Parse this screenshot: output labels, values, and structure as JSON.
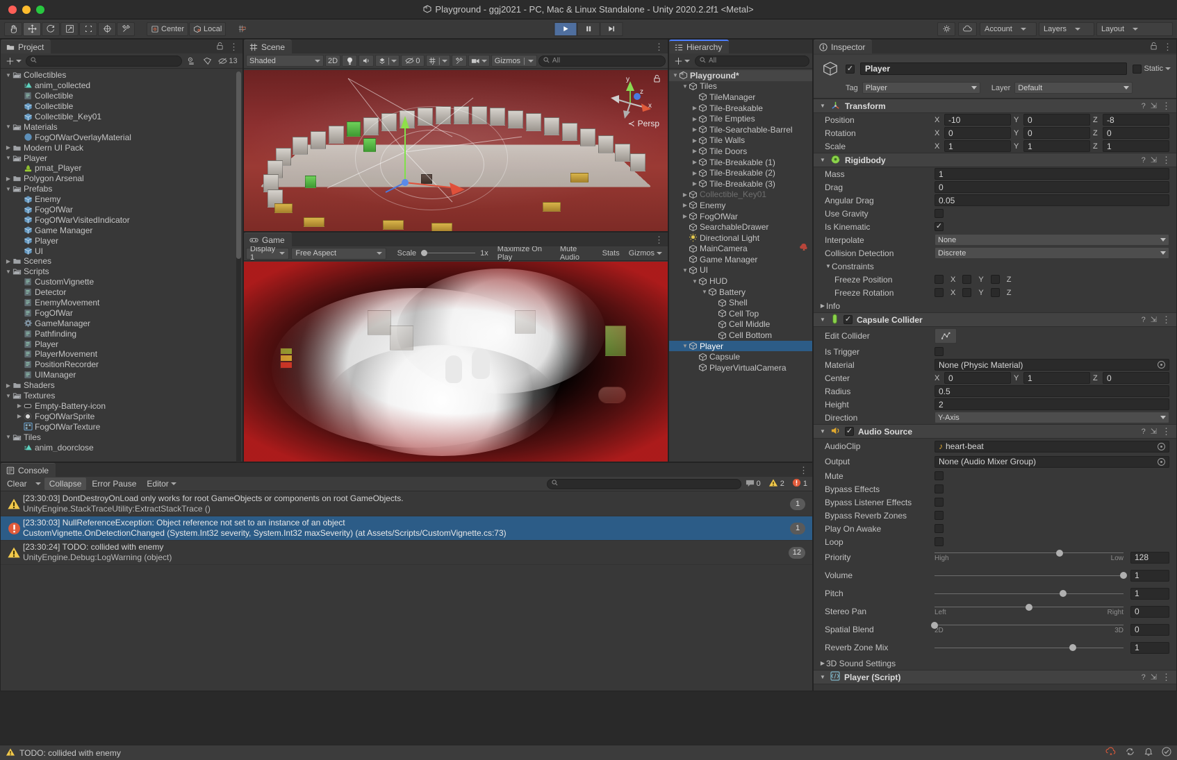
{
  "window": {
    "title": "Playground - ggj2021 - PC, Mac & Linux Standalone - Unity 2020.2.2f1 <Metal>"
  },
  "toolbar": {
    "tools": [
      {
        "name": "hand-tool",
        "glyph": "✋"
      },
      {
        "name": "move-tool",
        "glyph": "✥"
      },
      {
        "name": "rotate-tool",
        "glyph": "⟳"
      },
      {
        "name": "scale-tool",
        "glyph": "⤢"
      },
      {
        "name": "rect-tool",
        "glyph": "⬚"
      },
      {
        "name": "transform-tool",
        "glyph": "✦"
      },
      {
        "name": "custom-tool",
        "glyph": "⚒"
      }
    ],
    "pivot_label": "Center",
    "space_label": "Local",
    "grid_label": "",
    "play": "▶",
    "pause": "❚❚",
    "step": "▶❙",
    "cloud_label": "",
    "account_label": "Account",
    "layers_label": "Layers",
    "layout_label": "Layout"
  },
  "project": {
    "tab_label": "Project",
    "search_placeholder": "",
    "hidden_count": "13",
    "tree": [
      {
        "depth": 1,
        "arrow": "▼",
        "icon": "folder-open",
        "label": "Collectibles"
      },
      {
        "depth": 2,
        "arrow": "",
        "icon": "anim",
        "label": "anim_collected"
      },
      {
        "depth": 2,
        "arrow": "",
        "icon": "script",
        "label": "Collectible"
      },
      {
        "depth": 2,
        "arrow": "",
        "icon": "prefab",
        "label": "Collectible"
      },
      {
        "depth": 2,
        "arrow": "",
        "icon": "prefab",
        "label": "Collectible_Key01"
      },
      {
        "depth": 1,
        "arrow": "▼",
        "icon": "folder-open",
        "label": "Materials"
      },
      {
        "depth": 2,
        "arrow": "",
        "icon": "material",
        "label": "FogOfWarOverlayMaterial"
      },
      {
        "depth": 1,
        "arrow": "▶",
        "icon": "folder",
        "label": "Modern UI Pack"
      },
      {
        "depth": 1,
        "arrow": "▼",
        "icon": "folder-open",
        "label": "Player"
      },
      {
        "depth": 2,
        "arrow": "",
        "icon": "pmat",
        "label": "pmat_Player"
      },
      {
        "depth": 1,
        "arrow": "▶",
        "icon": "folder",
        "label": "Polygon Arsenal"
      },
      {
        "depth": 1,
        "arrow": "▼",
        "icon": "folder-open",
        "label": "Prefabs"
      },
      {
        "depth": 2,
        "arrow": "",
        "icon": "prefab",
        "label": "Enemy"
      },
      {
        "depth": 2,
        "arrow": "",
        "icon": "prefab",
        "label": "FogOfWar"
      },
      {
        "depth": 2,
        "arrow": "",
        "icon": "prefab",
        "label": "FogOfWarVisitedIndicator"
      },
      {
        "depth": 2,
        "arrow": "",
        "icon": "prefab",
        "label": "Game Manager"
      },
      {
        "depth": 2,
        "arrow": "",
        "icon": "prefab",
        "label": "Player"
      },
      {
        "depth": 2,
        "arrow": "",
        "icon": "prefab",
        "label": "UI"
      },
      {
        "depth": 1,
        "arrow": "▶",
        "icon": "folder",
        "label": "Scenes"
      },
      {
        "depth": 1,
        "arrow": "▼",
        "icon": "folder-open",
        "label": "Scripts"
      },
      {
        "depth": 2,
        "arrow": "",
        "icon": "script",
        "label": "CustomVignette"
      },
      {
        "depth": 2,
        "arrow": "",
        "icon": "script",
        "label": "Detector"
      },
      {
        "depth": 2,
        "arrow": "",
        "icon": "script",
        "label": "EnemyMovement"
      },
      {
        "depth": 2,
        "arrow": "",
        "icon": "script",
        "label": "FogOfWar"
      },
      {
        "depth": 2,
        "arrow": "",
        "icon": "gear",
        "label": "GameManager"
      },
      {
        "depth": 2,
        "arrow": "",
        "icon": "script",
        "label": "Pathfinding"
      },
      {
        "depth": 2,
        "arrow": "",
        "icon": "script",
        "label": "Player"
      },
      {
        "depth": 2,
        "arrow": "",
        "icon": "script",
        "label": "PlayerMovement"
      },
      {
        "depth": 2,
        "arrow": "",
        "icon": "script",
        "label": "PositionRecorder"
      },
      {
        "depth": 2,
        "arrow": "",
        "icon": "script",
        "label": "UIManager"
      },
      {
        "depth": 1,
        "arrow": "▶",
        "icon": "folder",
        "label": "Shaders"
      },
      {
        "depth": 1,
        "arrow": "▼",
        "icon": "folder-open",
        "label": "Textures"
      },
      {
        "depth": 2,
        "arrow": "▶",
        "icon": "sprite",
        "label": "Empty-Battery-icon"
      },
      {
        "depth": 2,
        "arrow": "▶",
        "icon": "dot",
        "label": "FogOfWarSprite"
      },
      {
        "depth": 2,
        "arrow": "",
        "icon": "texture",
        "label": "FogOfWarTexture"
      },
      {
        "depth": 1,
        "arrow": "▼",
        "icon": "folder-open",
        "label": "Tiles"
      },
      {
        "depth": 2,
        "arrow": "",
        "icon": "anim",
        "label": "anim_doorclose"
      }
    ]
  },
  "scene": {
    "tab_label": "Scene",
    "shading_mode": "Shaded",
    "mode_2d": "2D",
    "audio_count": "0",
    "gizmos_label": "Gizmos",
    "search_placeholder": "All",
    "persp_label": "Persp",
    "axis_x": "x",
    "axis_y": "y",
    "axis_z": "z"
  },
  "game": {
    "tab_label": "Game",
    "display": "Display 1",
    "aspect": "Free Aspect",
    "scale_label": "Scale",
    "scale_value": "1x",
    "maximize_label": "Maximize On Play",
    "mute_label": "Mute Audio",
    "stats_label": "Stats",
    "gizmos_label": "Gizmos"
  },
  "hierarchy": {
    "tab_label": "Hierarchy",
    "search_placeholder": "All",
    "items": [
      {
        "depth": 0,
        "arrow": "▼",
        "icon": "scene",
        "label": "Playground*",
        "style": "scene-root"
      },
      {
        "depth": 1,
        "arrow": "▼",
        "icon": "cube",
        "label": "Tiles",
        "style": ""
      },
      {
        "depth": 2,
        "arrow": "",
        "icon": "cube",
        "label": "TileManager",
        "style": ""
      },
      {
        "depth": 2,
        "arrow": "▶",
        "icon": "cube",
        "label": "Tile-Breakable",
        "style": ""
      },
      {
        "depth": 2,
        "arrow": "▶",
        "icon": "cube",
        "label": "Tile Empties",
        "style": ""
      },
      {
        "depth": 2,
        "arrow": "▶",
        "icon": "cube",
        "label": "Tile-Searchable-Barrel",
        "style": ""
      },
      {
        "depth": 2,
        "arrow": "▶",
        "icon": "cube",
        "label": "Tile Walls",
        "style": ""
      },
      {
        "depth": 2,
        "arrow": "▶",
        "icon": "cube",
        "label": "Tile Doors",
        "style": ""
      },
      {
        "depth": 2,
        "arrow": "▶",
        "icon": "cube",
        "label": "Tile-Breakable (1)",
        "style": ""
      },
      {
        "depth": 2,
        "arrow": "▶",
        "icon": "cube",
        "label": "Tile-Breakable (2)",
        "style": ""
      },
      {
        "depth": 2,
        "arrow": "▶",
        "icon": "cube",
        "label": "Tile-Breakable (3)",
        "style": ""
      },
      {
        "depth": 1,
        "arrow": "▶",
        "icon": "cube",
        "label": "Collectible_Key01",
        "style": "dim"
      },
      {
        "depth": 1,
        "arrow": "▶",
        "icon": "cube",
        "label": "Enemy",
        "style": ""
      },
      {
        "depth": 1,
        "arrow": "▶",
        "icon": "cube",
        "label": "FogOfWar",
        "style": ""
      },
      {
        "depth": 1,
        "arrow": "",
        "icon": "cube",
        "label": "SearchableDrawer",
        "style": ""
      },
      {
        "depth": 1,
        "arrow": "",
        "icon": "light",
        "label": "Directional Light",
        "style": ""
      },
      {
        "depth": 1,
        "arrow": "",
        "icon": "cube",
        "label": "MainCamera",
        "style": "has-badge"
      },
      {
        "depth": 1,
        "arrow": "",
        "icon": "cube",
        "label": "Game Manager",
        "style": ""
      },
      {
        "depth": 1,
        "arrow": "▼",
        "icon": "cube",
        "label": "UI",
        "style": ""
      },
      {
        "depth": 2,
        "arrow": "▼",
        "icon": "cube",
        "label": "HUD",
        "style": ""
      },
      {
        "depth": 3,
        "arrow": "▼",
        "icon": "cube",
        "label": "Battery",
        "style": ""
      },
      {
        "depth": 4,
        "arrow": "",
        "icon": "cube",
        "label": "Shell",
        "style": ""
      },
      {
        "depth": 4,
        "arrow": "",
        "icon": "cube",
        "label": "Cell Top",
        "style": ""
      },
      {
        "depth": 4,
        "arrow": "",
        "icon": "cube",
        "label": "Cell Middle",
        "style": ""
      },
      {
        "depth": 4,
        "arrow": "",
        "icon": "cube",
        "label": "Cell Bottom",
        "style": ""
      },
      {
        "depth": 1,
        "arrow": "▼",
        "icon": "cube",
        "label": "Player",
        "style": "sel"
      },
      {
        "depth": 2,
        "arrow": "",
        "icon": "cube",
        "label": "Capsule",
        "style": ""
      },
      {
        "depth": 2,
        "arrow": "",
        "icon": "cube",
        "label": "PlayerVirtualCamera",
        "style": ""
      }
    ]
  },
  "inspector": {
    "tab_label": "Inspector",
    "object_name": "Player",
    "static_label": "Static",
    "tag_label": "Tag",
    "tag_value": "Player",
    "layer_label": "Layer",
    "layer_value": "Default",
    "transform": {
      "title": "Transform",
      "rows": [
        {
          "label": "Position",
          "x": "-10",
          "y": "0",
          "z": "-8"
        },
        {
          "label": "Rotation",
          "x": "0",
          "y": "0",
          "z": "0"
        },
        {
          "label": "Scale",
          "x": "1",
          "y": "1",
          "z": "1"
        }
      ]
    },
    "rigidbody": {
      "title": "Rigidbody",
      "mass_label": "Mass",
      "mass": "1",
      "drag_label": "Drag",
      "drag": "0",
      "angular_drag_label": "Angular Drag",
      "angular_drag": "0.05",
      "use_gravity_label": "Use Gravity",
      "use_gravity": false,
      "is_kinematic_label": "Is Kinematic",
      "is_kinematic": true,
      "interpolate_label": "Interpolate",
      "interpolate": "None",
      "collision_detection_label": "Collision Detection",
      "collision_detection": "Discrete",
      "constraints_label": "Constraints",
      "freeze_position_label": "Freeze Position",
      "freeze_rotation_label": "Freeze Rotation",
      "axes": [
        "X",
        "Y",
        "Z"
      ],
      "info_label": "Info"
    },
    "capsule_collider": {
      "title": "Capsule Collider",
      "edit_collider_label": "Edit Collider",
      "is_trigger_label": "Is Trigger",
      "material_label": "Material",
      "material": "None (Physic Material)",
      "center_label": "Center",
      "center_x": "0",
      "center_y": "1",
      "center_z": "0",
      "radius_label": "Radius",
      "radius": "0.5",
      "height_label": "Height",
      "height": "2",
      "direction_label": "Direction",
      "direction": "Y-Axis"
    },
    "audio_source": {
      "title": "Audio Source",
      "audioclip_label": "AudioClip",
      "audioclip": "heart-beat",
      "output_label": "Output",
      "output": "None (Audio Mixer Group)",
      "mute_label": "Mute",
      "bypass_effects_label": "Bypass Effects",
      "bypass_listener_label": "Bypass Listener Effects",
      "bypass_reverb_label": "Bypass Reverb Zones",
      "play_on_awake_label": "Play On Awake",
      "loop_label": "Loop",
      "priority_label": "Priority",
      "priority": "128",
      "priority_left": "High",
      "priority_right": "Low",
      "priority_pct": 66,
      "volume_label": "Volume",
      "volume": "1",
      "volume_pct": 100,
      "pitch_label": "Pitch",
      "pitch": "1",
      "pitch_pct": 68,
      "stereo_pan_label": "Stereo Pan",
      "stereo_pan": "0",
      "pan_left": "Left",
      "pan_right": "Right",
      "pan_pct": 50,
      "spatial_blend_label": "Spatial Blend",
      "spatial_blend": "0",
      "blend_left": "2D",
      "blend_right": "3D",
      "blend_pct": 0,
      "reverb_zone_label": "Reverb Zone Mix",
      "reverb_zone": "1",
      "reverb_pct": 73,
      "sound_settings_label": "3D Sound Settings"
    },
    "player_script": {
      "title": "Player (Script)"
    }
  },
  "console": {
    "tab_label": "Console",
    "clear_label": "Clear",
    "collapse_label": "Collapse",
    "error_pause_label": "Error Pause",
    "editor_label": "Editor",
    "search_placeholder": "",
    "counts": {
      "log": "0",
      "warning": "2",
      "error": "1"
    },
    "messages": [
      {
        "type": "warning",
        "line1": "[23:30:03] DontDestroyOnLoad only works for root GameObjects or components on root GameObjects.",
        "line2": "UnityEngine.StackTraceUtility:ExtractStackTrace ()",
        "badge": "1",
        "selected": false
      },
      {
        "type": "error",
        "line1": "[23:30:03] NullReferenceException: Object reference not set to an instance of an object",
        "line2": "CustomVignette.OnDetectionChanged (System.Int32 severity, System.Int32 maxSeverity) (at Assets/Scripts/CustomVignette.cs:73)",
        "badge": "1",
        "selected": true
      },
      {
        "type": "warning",
        "line1": "[23:30:24] TODO: collided with enemy",
        "line2": "UnityEngine.Debug:LogWarning (object)",
        "badge": "12",
        "selected": false
      }
    ]
  },
  "statusbar": {
    "message": "TODO: collided with enemy"
  },
  "colors": {
    "accent_blue": "#2c5c87",
    "play_blue": "#4f6f9f",
    "warning": "#f2c94c",
    "error": "#e05a3a",
    "panel_bg": "#383838",
    "toolbar_bg": "#393939"
  }
}
